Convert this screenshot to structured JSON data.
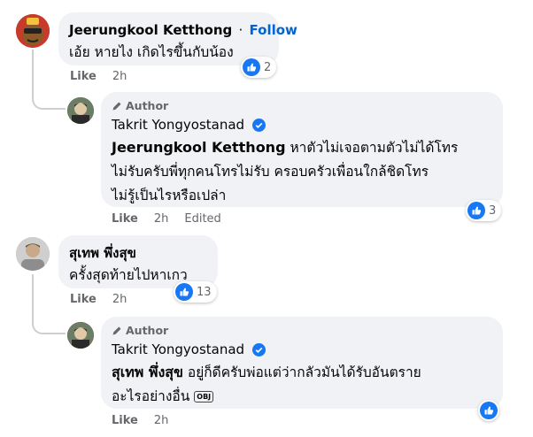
{
  "comments": [
    {
      "author": "Jeerungkool Ketthong",
      "follow_label": "Follow",
      "separator": "·",
      "text": "เอ้ย หายไง เกิดไรขึ้นกับน้อง",
      "like_label": "Like",
      "time": "2h",
      "reaction_count": "2"
    },
    {
      "badge": "Author",
      "author": "Takrit Yongyostanad",
      "mention": "Jeerungkool Ketthong",
      "text_line1": " หาตัวไม่เจอตามตัวไม่ได้โทร",
      "text_line2": "ไม่รับครับพี่ทุกคนโทรไม่รับ ครอบครัวเพื่อนใกล้ชิดโทร",
      "text_line3": "ไม่รู้เป็นไรหรือเปล่า",
      "like_label": "Like",
      "time": "2h",
      "edited": "Edited",
      "reaction_count": "3"
    },
    {
      "author": "สุเทพ พึ่งสุข",
      "text": "ครั้งสุดท้ายไปหาเกว",
      "like_label": "Like",
      "time": "2h",
      "reaction_count": "13"
    },
    {
      "badge": "Author",
      "author": "Takrit Yongyostanad",
      "mention": "สุเทพ พึ่งสุข",
      "text_line1": " อยู่ก็ดีครับพ่อแต่ว่ากลัวมันได้รับอันตราย",
      "text_line2": "อะไรอย่างอื่น",
      "emoji_text": "OBJ",
      "like_label": "Like",
      "time": "2h"
    }
  ],
  "colors": {
    "bubble": "#f0f2f5",
    "like_blue": "#1877f2",
    "link_blue": "#0064d1",
    "meta_gray": "#65676b"
  },
  "icons": [
    "thumbs-up-icon",
    "verified-badge-icon",
    "pen-author-icon"
  ]
}
